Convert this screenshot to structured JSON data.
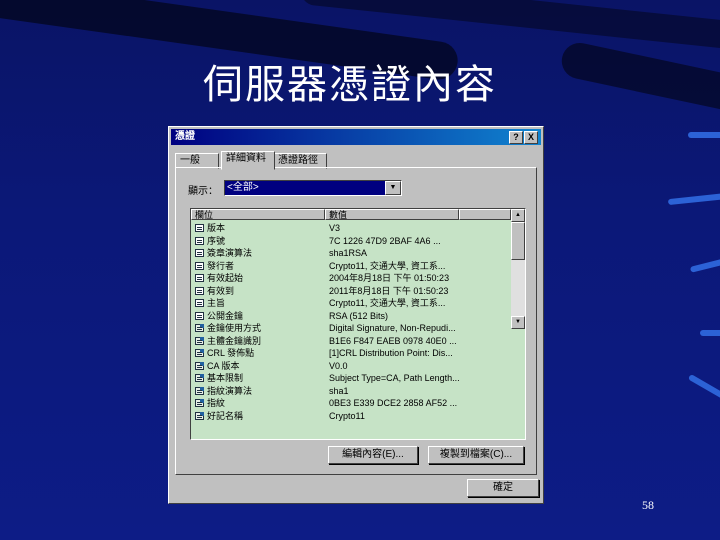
{
  "slide": {
    "title": "伺服器憑證內容",
    "page_number": "58"
  },
  "dialog": {
    "title": "憑證",
    "help_button": "?",
    "close_button": "X",
    "tabs": [
      {
        "label": "一般",
        "active": false
      },
      {
        "label": "詳細資料",
        "active": true
      },
      {
        "label": "憑證路徑",
        "active": false
      }
    ],
    "show_label": "顯示：",
    "show_value": "<全部>",
    "columns": [
      "欄位",
      "數值",
      ""
    ],
    "rows": [
      {
        "field": "版本",
        "value": "V3",
        "type": "field"
      },
      {
        "field": "序號",
        "value": "7C 1226 47D9 2BAF 4A6 ...",
        "type": "field"
      },
      {
        "field": "簽章演算法",
        "value": "sha1RSA",
        "type": "field"
      },
      {
        "field": "發行者",
        "type": "field",
        "value": "Crypto11, 交通大學, 資工系..."
      },
      {
        "field": "有效起始",
        "value": "2004年8月18日 下午 01:50:23",
        "type": "field"
      },
      {
        "field": "有效到",
        "value": "2011年8月18日 下午 01:50:23",
        "type": "field"
      },
      {
        "field": "主旨",
        "value": "Crypto11, 交通大學, 資工系...",
        "type": "field"
      },
      {
        "field": "公開金鑰",
        "value": "RSA (512 Bits)",
        "type": "field"
      },
      {
        "field": "金鑰使用方式",
        "value": "Digital Signature, Non-Repudi...",
        "type": "ext"
      },
      {
        "field": "主體金鑰識別",
        "value": "B1E6 F847 EAEB 0978 40E0 ...",
        "type": "ext"
      },
      {
        "field": "CRL 發佈點",
        "value": "[1]CRL Distribution Point: Dis...",
        "type": "ext"
      },
      {
        "field": "CA 版本",
        "value": "V0.0",
        "type": "ext"
      },
      {
        "field": "基本限制",
        "value": "Subject Type=CA, Path Length...",
        "type": "ext"
      },
      {
        "field": "指紋演算法",
        "value": "sha1",
        "type": "ext"
      },
      {
        "field": "指紋",
        "value": "0BE3 E339 DCE2 2858 AF52 ...",
        "type": "ext"
      },
      {
        "field": "好記名稱",
        "value": "Crypto11",
        "type": "ext"
      }
    ],
    "edit_button": "編輯內容(E)...",
    "copy_button": "複製到檔案(C)...",
    "ok_button": "確定"
  }
}
